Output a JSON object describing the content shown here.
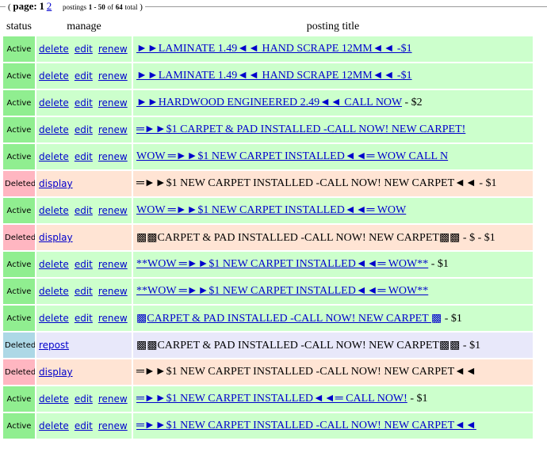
{
  "pager": {
    "label": "page:",
    "current_page": "1",
    "other_page": "2",
    "postings_prefix": "postings",
    "range": "1 - 50",
    "of_label": "of",
    "total": "64",
    "total_suffix": "total"
  },
  "table": {
    "headers": {
      "status": "status",
      "manage": "manage",
      "title": "posting title"
    },
    "rows": [
      {
        "status": "Active",
        "actions": [
          "delete",
          "edit",
          "renew"
        ],
        "title": "►►LAMINATE 1.49◄◄ HAND SCRAPE 12MM◄◄ -$1",
        "price": ""
      },
      {
        "status": "Active",
        "actions": [
          "delete",
          "edit",
          "renew"
        ],
        "title": "►►LAMINATE 1.49◄◄ HAND SCRAPE 12MM◄◄ -$1",
        "price": ""
      },
      {
        "status": "Active",
        "actions": [
          "delete",
          "edit",
          "renew"
        ],
        "title": "►►HARDWOOD ENGINEERED 2.49◄◄ CALL NOW",
        "price": " - $2"
      },
      {
        "status": "Active",
        "actions": [
          "delete",
          "edit",
          "renew"
        ],
        "title": "═►►$1 CARPET & PAD INSTALLED -CALL NOW! NEW CARPET!",
        "price": ""
      },
      {
        "status": "Active",
        "actions": [
          "delete",
          "edit",
          "renew"
        ],
        "title": "WOW ═►►$1 NEW CARPET INSTALLED◄◄═ WOW CALL N",
        "price": ""
      },
      {
        "status": "Deleted",
        "actions": [
          "display"
        ],
        "title": "═►►$1 NEW CARPET INSTALLED -CALL NOW! NEW CARPET◄◄",
        "price": " - $1"
      },
      {
        "status": "Active",
        "actions": [
          "delete",
          "edit",
          "renew"
        ],
        "title": "WOW ═►►$1 NEW CARPET INSTALLED◄◄═ WOW",
        "price": ""
      },
      {
        "status": "Deleted",
        "actions": [
          "display"
        ],
        "title": "▩▩CARPET & PAD INSTALLED -CALL NOW! NEW CARPET▩▩",
        "price": " - $ - $1"
      },
      {
        "status": "Active",
        "actions": [
          "delete",
          "edit",
          "renew"
        ],
        "title": "**WOW ═►►$1 NEW CARPET INSTALLED◄◄═ WOW**",
        "price": " - $1"
      },
      {
        "status": "Active",
        "actions": [
          "delete",
          "edit",
          "renew"
        ],
        "title": "**WOW ═►►$1 NEW CARPET INSTALLED◄◄═ WOW**",
        "price": ""
      },
      {
        "status": "Active",
        "actions": [
          "delete",
          "edit",
          "renew"
        ],
        "title": "▩CARPET & PAD INSTALLED -CALL NOW! NEW CARPET ▩",
        "price": " - $1"
      },
      {
        "status": "Deleted",
        "actions": [
          "repost"
        ],
        "title": "▩▩CARPET & PAD INSTALLED -CALL NOW! NEW CARPET▩▩",
        "price": " - $1"
      },
      {
        "status": "Deleted",
        "actions": [
          "display"
        ],
        "title": "═►►$1 NEW CARPET INSTALLED -CALL NOW! NEW CARPET◄◄",
        "price": ""
      },
      {
        "status": "Active",
        "actions": [
          "delete",
          "edit",
          "renew"
        ],
        "title": "═►►$1 NEW CARPET INSTALLED◄◄═ CALL NOW!",
        "price": " - $1"
      },
      {
        "status": "Active",
        "actions": [
          "delete",
          "edit",
          "renew"
        ],
        "title": "═►►$1 NEW CARPET INSTALLED -CALL NOW! NEW CARPET◄◄",
        "price": ""
      }
    ]
  },
  "colors": {
    "active_status_bg": "#90ee90",
    "active_row_bg": "#ccffcc",
    "deleted_status_bg": "#ffb6c1",
    "deleted_row_bg": "#ffe4d4",
    "repost_status_bg": "#add8e6",
    "repost_row_bg": "#e8e8fa",
    "link": "#0000cc"
  }
}
